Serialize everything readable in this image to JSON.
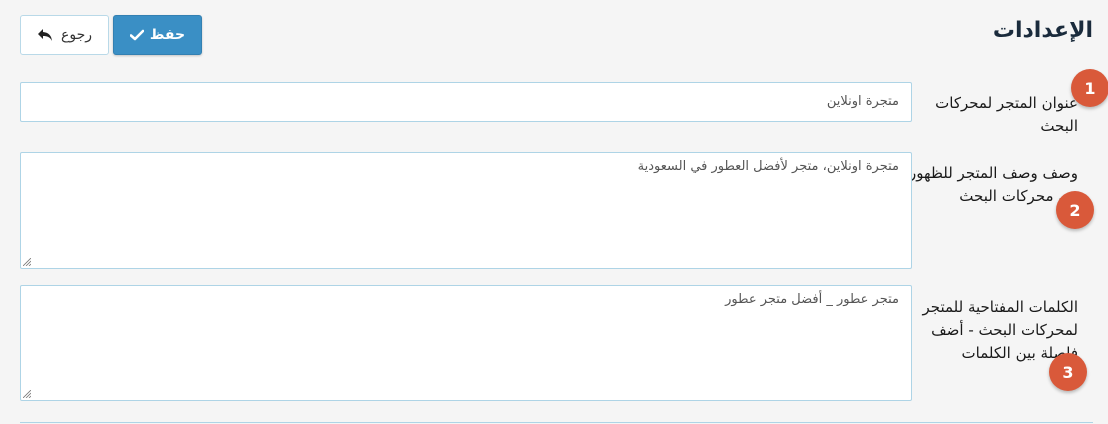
{
  "header": {
    "title": "الإعدادات",
    "save_label": "حفظ",
    "back_label": "رجوع"
  },
  "fields": [
    {
      "badge": "1",
      "label": "عنوان المتجر لمحركات البحث",
      "value": "متجرة اونلاين"
    },
    {
      "badge": "2",
      "label": "وصف وصف المتجر للظهور في محركات البحث",
      "value": "متجرة اونلاين، متجر لأفضل العطور في السعودية"
    },
    {
      "badge": "3",
      "label": "الكلمات المفتاحية للمتجر لمحركات البحث - أضف فاصلة بين الكلمات",
      "value": "متجر عطور _ أفضل متجر عطور"
    }
  ],
  "icons": {
    "save": "check-icon",
    "back": "reply-arrow-icon"
  },
  "colors": {
    "primary": "#3a8fc5",
    "badge": "#d9593a",
    "field_border": "#aed4e6"
  }
}
